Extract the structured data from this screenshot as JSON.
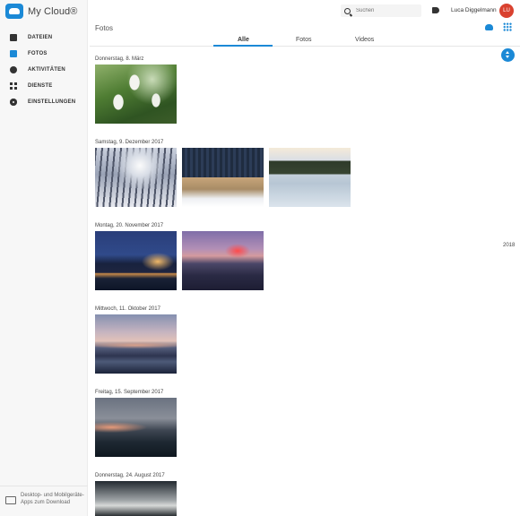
{
  "app": {
    "name": "My Cloud®"
  },
  "sidebar": {
    "items": [
      {
        "label": "DATEIEN",
        "icon": "file-icon"
      },
      {
        "label": "FOTOS",
        "icon": "photo-icon",
        "active": true
      },
      {
        "label": "AKTIVITÄTEN",
        "icon": "clock-icon"
      },
      {
        "label": "DIENSTE",
        "icon": "grid-icon"
      },
      {
        "label": "EINSTELLUNGEN",
        "icon": "gear-icon"
      }
    ],
    "download": {
      "text": "Desktop- und Mobilgeräte-Apps zum Download",
      "icon": "devices-icon"
    }
  },
  "header": {
    "search_placeholder": "Suchen",
    "user_name": "Luca Diggelmann",
    "avatar_initials": "LU",
    "avatar_color": "#d9412f"
  },
  "main": {
    "title": "Fotos",
    "tabs": [
      {
        "label": "Alle",
        "active": true
      },
      {
        "label": "Fotos",
        "active": false
      },
      {
        "label": "Videos",
        "active": false
      }
    ],
    "year_marker": "2018",
    "sections": [
      {
        "date": "Donnerstag, 8. März",
        "photos": [
          "snowdrops"
        ]
      },
      {
        "date": "Samstag, 9. Dezember 2017",
        "photos": [
          "snowy-forest",
          "frozen-reeds",
          "frozen-lake"
        ]
      },
      {
        "date": "Montag, 20. November 2017",
        "photos": [
          "city-night-castle",
          "harbor-dusk"
        ]
      },
      {
        "date": "Mittwoch, 11. Oktober 2017",
        "photos": [
          "lake-city-evening"
        ]
      },
      {
        "date": "Freitag, 15. September 2017",
        "photos": [
          "sunset-over-city"
        ]
      },
      {
        "date": "Donnerstag, 24. August 2017",
        "photos": [
          "overcast-landscape"
        ]
      }
    ]
  },
  "colors": {
    "accent": "#1b89d6",
    "sidebar_bg": "#f7f7f7"
  }
}
